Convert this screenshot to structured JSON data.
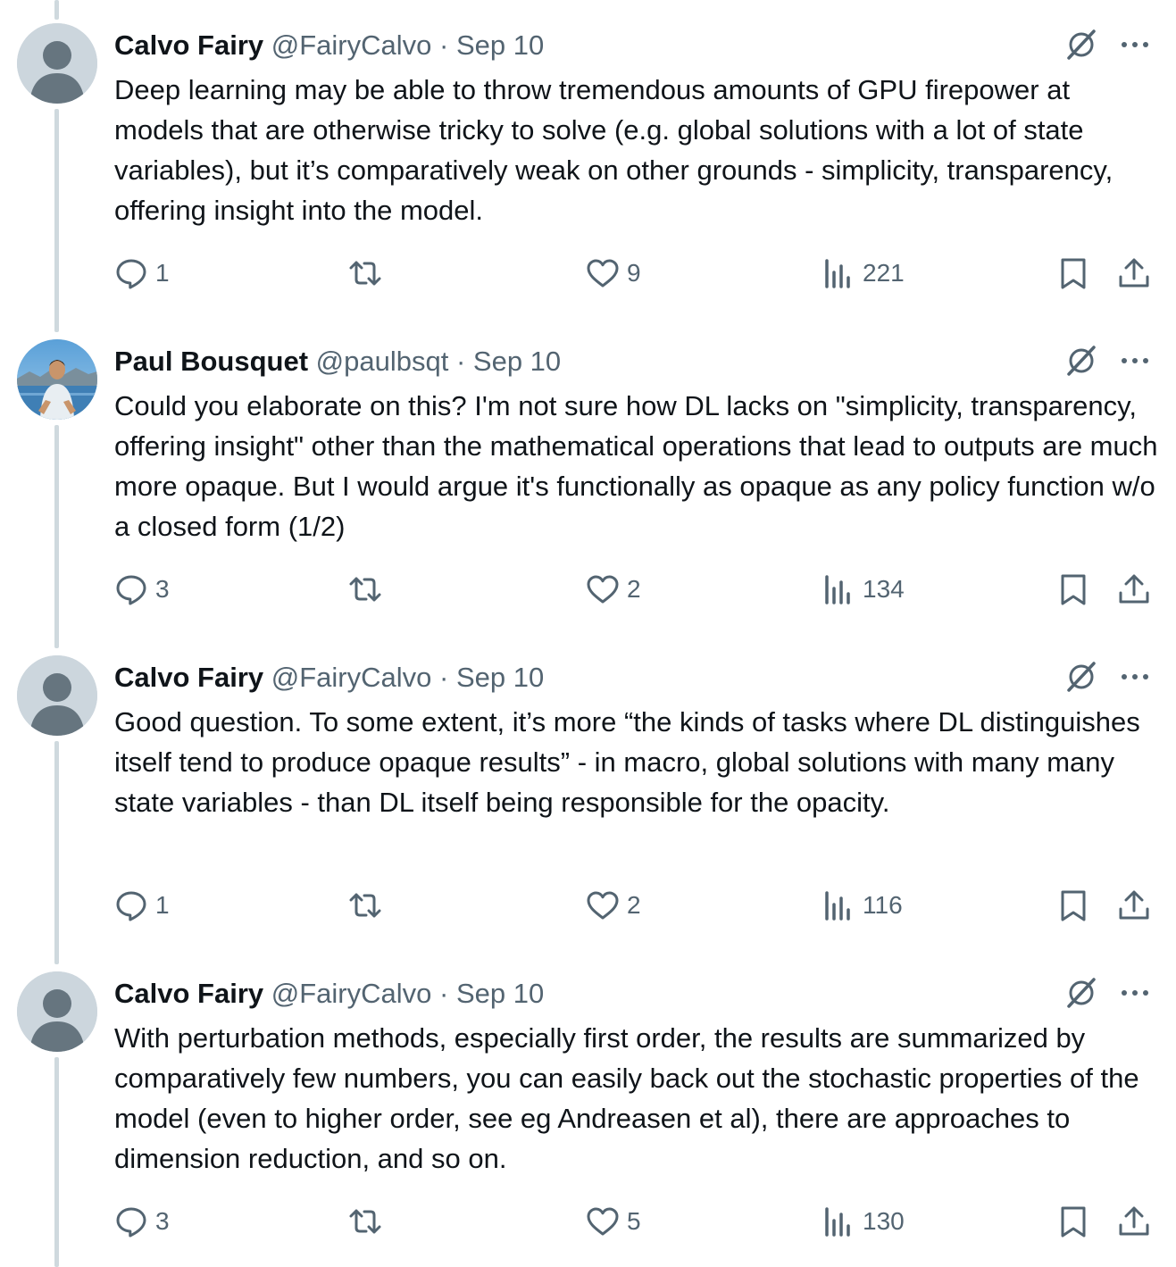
{
  "tweets": [
    {
      "author": "Calvo Fairy",
      "handle": "@FairyCalvo",
      "separator": "·",
      "date": "Sep 10",
      "avatar": "default-avatar",
      "text": "Deep learning may be able to throw tremendous amounts of GPU firepower at models that are otherwise tricky to solve (e.g. global solutions with a lot of state variables), but it’s comparatively weak on other grounds - simplicity, transparency, offering insight into the model.",
      "replies": "1",
      "retweets": "",
      "likes": "9",
      "views": "221"
    },
    {
      "author": "Paul Bousquet",
      "handle": "@paulbsqt",
      "separator": "·",
      "date": "Sep 10",
      "avatar": "photo-avatar",
      "text": "Could you elaborate on this? I'm not sure how DL lacks on \"simplicity, transparency, offering insight\" other than the mathematical operations that lead to outputs are much more opaque. But I would argue it's functionally as opaque as any policy function w/o a closed form (1/2)",
      "replies": "3",
      "retweets": "",
      "likes": "2",
      "views": "134"
    },
    {
      "author": "Calvo Fairy",
      "handle": "@FairyCalvo",
      "separator": "·",
      "date": "Sep 10",
      "avatar": "default-avatar",
      "text": "Good question. To some extent, it’s more “the kinds of tasks where DL distinguishes itself tend to produce opaque results” - in macro, global solutions with many many state variables - than DL itself being responsible for the opacity.",
      "replies": "1",
      "retweets": "",
      "likes": "2",
      "views": "116"
    },
    {
      "author": "Calvo Fairy",
      "handle": "@FairyCalvo",
      "separator": "·",
      "date": "Sep 10",
      "avatar": "default-avatar",
      "text": "With perturbation methods, especially first order, the results are summarized by comparatively few numbers, you can easily back out the stochastic properties of the model (even to higher order, see eg Andreasen et al), there are approaches to dimension reduction, and so on.",
      "replies": "3",
      "retweets": "",
      "likes": "5",
      "views": "130"
    }
  ],
  "icons": {
    "reply": "reply-icon",
    "retweet": "retweet-icon",
    "like": "heart-icon",
    "views": "views-icon",
    "bookmark": "bookmark-icon",
    "share": "share-icon",
    "grok": "grok-icon",
    "more": "more-icon"
  },
  "colors": {
    "text": "#0f1419",
    "secondary": "#536471",
    "thread_line": "#cfd9de"
  }
}
